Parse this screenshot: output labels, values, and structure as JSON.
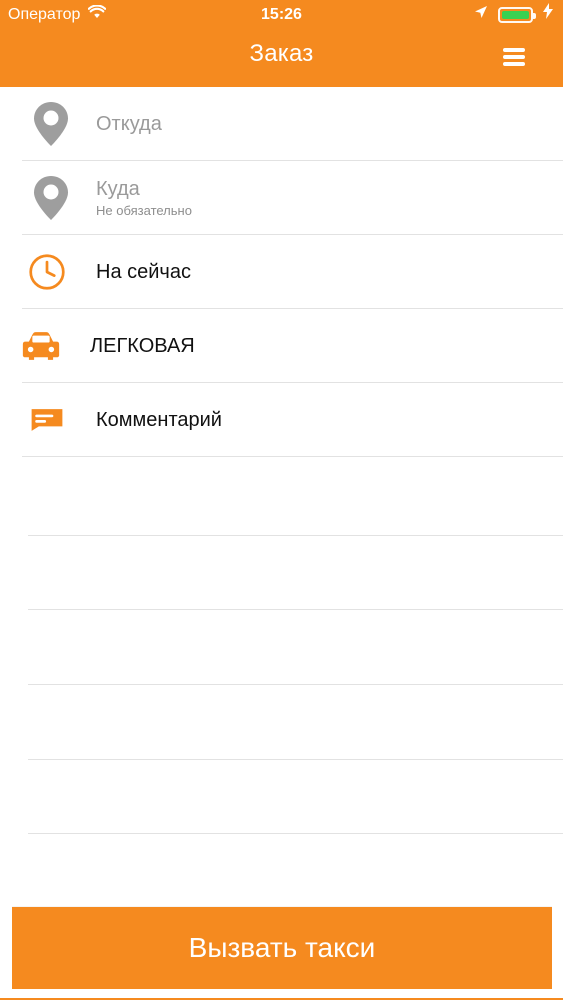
{
  "status_bar": {
    "carrier": "Оператор",
    "time": "15:26"
  },
  "header": {
    "title": "Заказ"
  },
  "rows": [
    {
      "label": "Откуда"
    },
    {
      "label": "Куда",
      "sublabel": "Не обязательно"
    },
    {
      "label": "На сейчас"
    },
    {
      "label": "ЛЕГКОВАЯ"
    },
    {
      "label": "Комментарий"
    }
  ],
  "call_button": {
    "label": "Вызвать такси"
  },
  "colors": {
    "accent": "#f58a1f",
    "pin": "#9e9e9e",
    "battery": "#39d152"
  },
  "icons": {
    "wifi": "wifi-icon",
    "location": "location-arrow-icon",
    "charging": "charging-bolt-icon",
    "menu": "hamburger-menu-icon",
    "pin": "map-pin-icon",
    "clock": "clock-icon",
    "car": "car-icon",
    "comment": "comment-icon"
  }
}
